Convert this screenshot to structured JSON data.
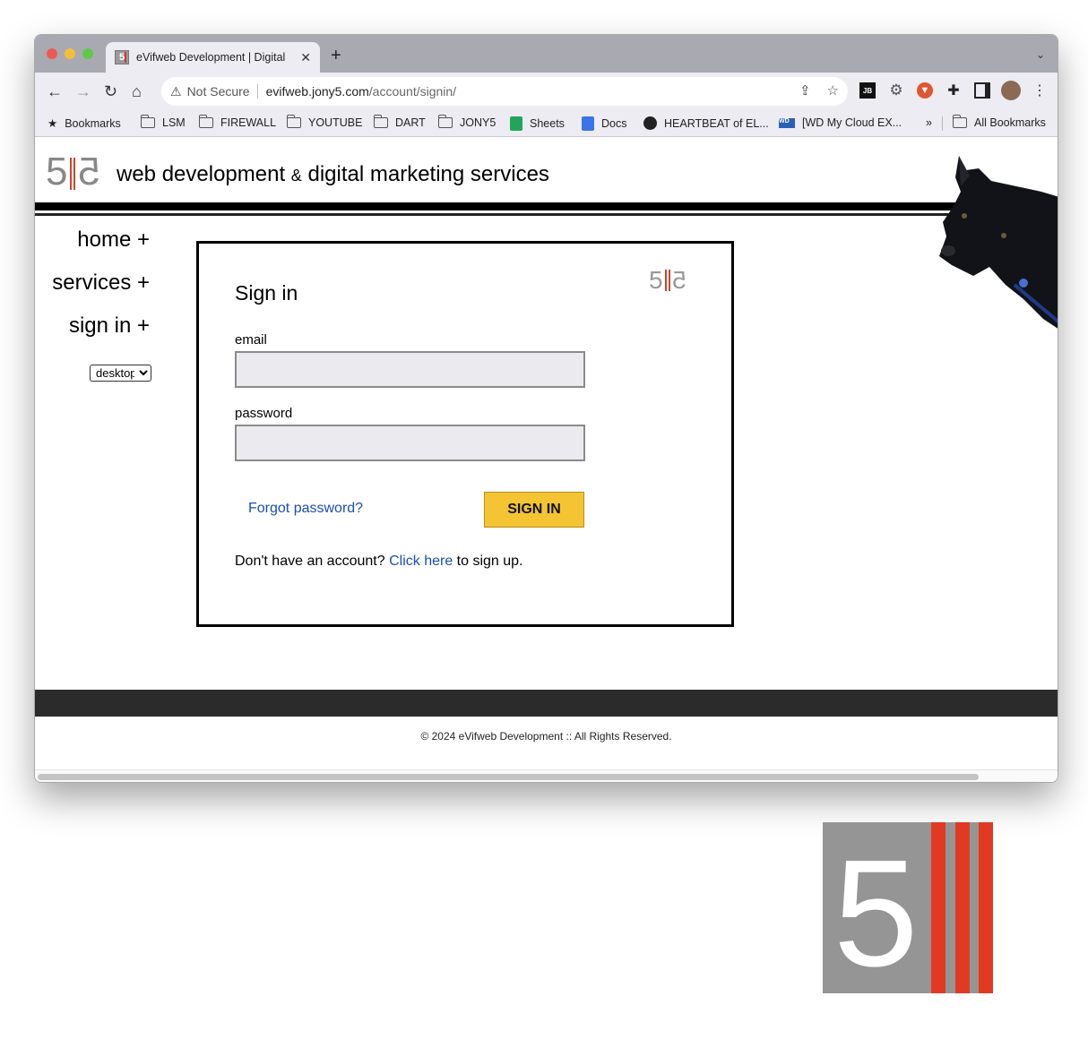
{
  "browser": {
    "tab_title": "eVifweb Development | Digital",
    "tab_favicon_text": "5",
    "address": {
      "security_label": "Not Secure",
      "host": "evifweb.jony5.com",
      "path": "/account/signin/"
    },
    "extensions": [
      "jetbrains-icon",
      "gear-extension-icon",
      "shield-extension-icon",
      "puzzle-icon",
      "sidepanel-icon",
      "profile-avatar",
      "kebab-menu-icon"
    ],
    "bookmarks": [
      {
        "label": "Bookmarks",
        "icon": "star-icon"
      },
      {
        "label": "LSM",
        "icon": "folder-icon"
      },
      {
        "label": "FIREWALL",
        "icon": "folder-icon"
      },
      {
        "label": "YOUTUBE",
        "icon": "folder-icon"
      },
      {
        "label": "DART",
        "icon": "folder-icon"
      },
      {
        "label": "JONY5",
        "icon": "folder-icon"
      },
      {
        "label": "Sheets",
        "icon": "sheets-icon"
      },
      {
        "label": "Docs",
        "icon": "docs-icon"
      },
      {
        "label": "HEARTBEAT of EL...",
        "icon": "globe-icon"
      },
      {
        "label": "[WD My Cloud EX...",
        "icon": "wd-icon"
      }
    ],
    "bookmarks_overflow": "»",
    "all_bookmarks": "All Bookmarks"
  },
  "site": {
    "logo_digit": "5",
    "title_part1": "web development",
    "title_amp": "&",
    "title_part2": "digital marketing services",
    "nav": [
      {
        "label": "home +"
      },
      {
        "label": "services +"
      },
      {
        "label": "sign in +"
      }
    ],
    "view_select": {
      "selected": "desktop"
    }
  },
  "signin": {
    "heading": "Sign in",
    "email_label": "email",
    "email_value": "",
    "password_label": "password",
    "password_value": "",
    "forgot_label": "Forgot password?",
    "submit_label": "SIGN IN",
    "signup_prefix": "Don't have an account?",
    "signup_link": "Click here",
    "signup_suffix": "to sign up."
  },
  "footer": {
    "copyright": "© 2024 eVifweb Development :: All Rights Reserved."
  },
  "colors": {
    "accent_red": "#c9452e",
    "button_yellow": "#f4c433",
    "link_blue": "#1a4db3",
    "footer_dark": "#2b2b2b"
  }
}
